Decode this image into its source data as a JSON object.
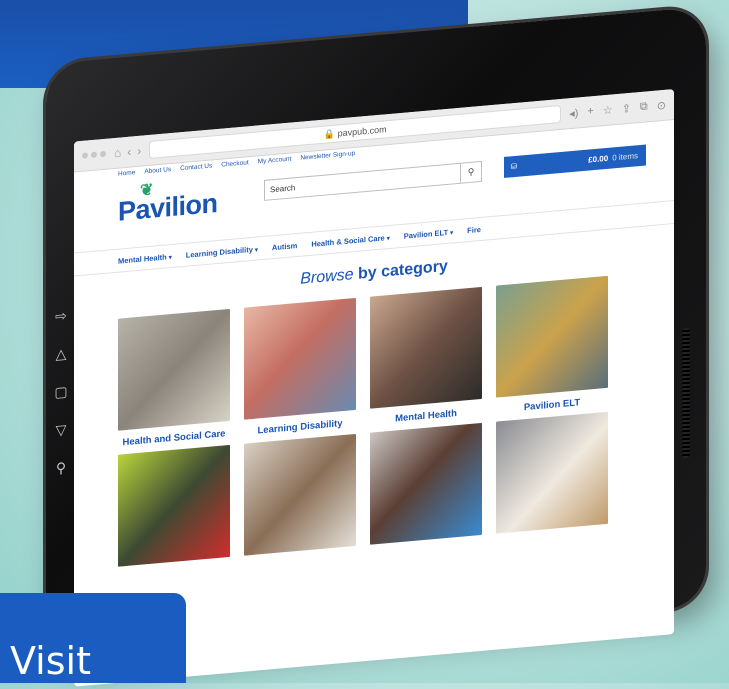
{
  "browser": {
    "url": "pavpub.com"
  },
  "site": {
    "top_links": [
      "Home",
      "About Us",
      "Contact Us",
      "Checkout",
      "My Account",
      "Newsletter Sign-up"
    ],
    "logo_text": "Pavilion",
    "search_placeholder": "Search",
    "cart": {
      "amount": "£0.00",
      "items": "0 items"
    },
    "main_nav": [
      {
        "label": "Mental Health",
        "dropdown": true
      },
      {
        "label": "Learning Disability",
        "dropdown": true
      },
      {
        "label": "Autism",
        "dropdown": false
      },
      {
        "label": "Health & Social Care",
        "dropdown": true
      },
      {
        "label": "Pavilion ELT",
        "dropdown": true
      },
      {
        "label": "Fire",
        "dropdown": false
      }
    ],
    "browse_heading": {
      "italic": "Browse",
      "bold": "by category"
    },
    "categories": [
      {
        "label": "Health and Social Care"
      },
      {
        "label": "Learning Disability"
      },
      {
        "label": "Mental Health"
      },
      {
        "label": "Pavilion ELT"
      },
      {
        "label": ""
      },
      {
        "label": ""
      },
      {
        "label": ""
      },
      {
        "label": ""
      }
    ]
  },
  "banner": {
    "visit_text": "Visit"
  },
  "colors": {
    "brand_blue": "#1a55b5",
    "leaf_green": "#27a26b",
    "banner_blue": "#1a5cc0"
  }
}
